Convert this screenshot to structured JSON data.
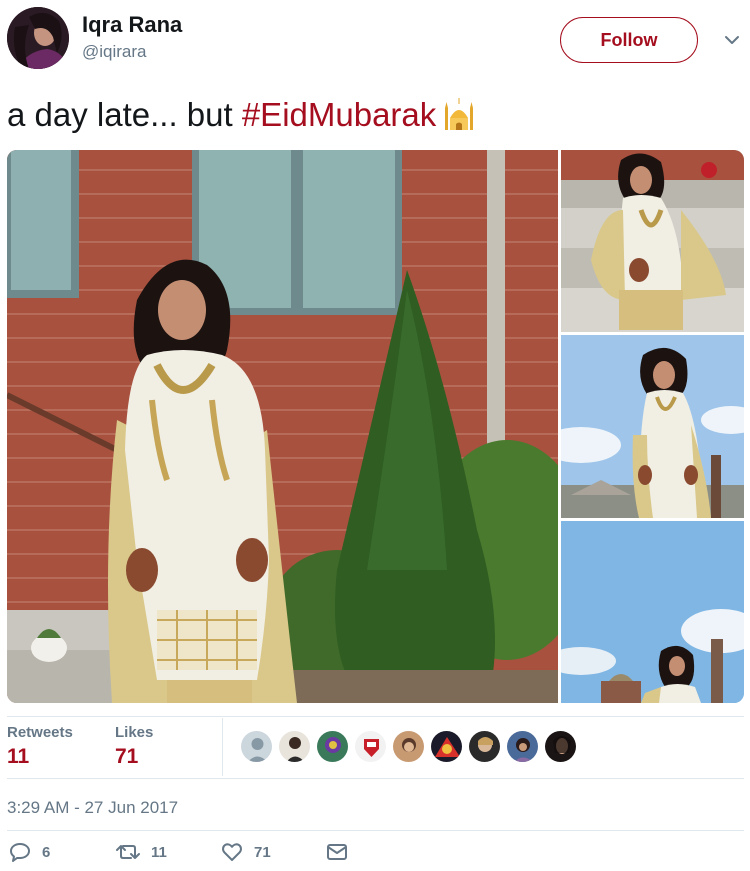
{
  "author": {
    "name": "Iqra Rana",
    "handle": "@iqirara",
    "avatar_icon": "profile-photo"
  },
  "follow_label": "Follow",
  "tweet": {
    "text_prefix": "a day late... but ",
    "hashtag": "#EidMubarak",
    "emoji": "mosque-icon"
  },
  "media": {
    "photos": [
      {
        "description": "main-photo"
      },
      {
        "description": "side-photo-1"
      },
      {
        "description": "side-photo-2"
      },
      {
        "description": "side-photo-3"
      }
    ]
  },
  "stats": {
    "retweets_label": "Retweets",
    "retweets_count": "11",
    "likes_label": "Likes",
    "likes_count": "71"
  },
  "timestamp": "3:29 AM - 27 Jun 2017",
  "actions": {
    "reply_count": "6",
    "retweet_count": "11",
    "like_count": "71"
  },
  "colors": {
    "accent": "#a40e1e",
    "secondary_text": "#657786",
    "divider": "#e1e8ed"
  }
}
